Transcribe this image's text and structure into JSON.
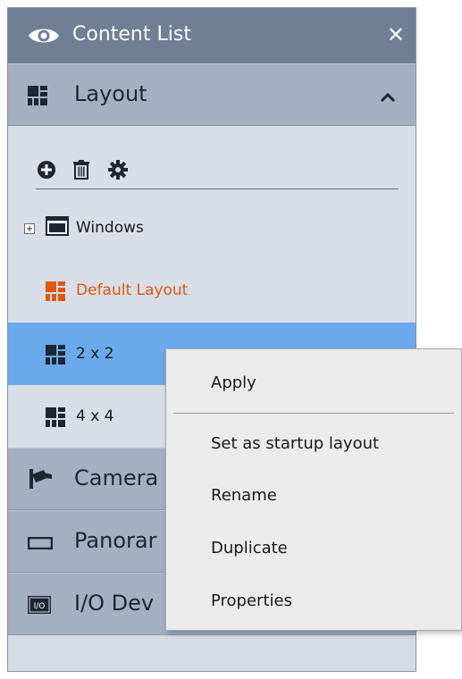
{
  "panel": {
    "title": "Content List",
    "close_glyph": "✕"
  },
  "sections": {
    "layout": {
      "label": "Layout",
      "expanded": true
    },
    "cameras": {
      "label": "Camera"
    },
    "panorama": {
      "label": "Panorar"
    },
    "io_devices": {
      "label": "I/O Dev"
    }
  },
  "toolbar": {
    "icons": [
      "add-icon",
      "trash-icon",
      "gear-icon"
    ]
  },
  "tree": {
    "items": [
      {
        "label": "Windows",
        "icon": "window-icon",
        "expander": "+"
      },
      {
        "label": "Default Layout",
        "icon": "layout-grid-icon",
        "color": "#e2580b"
      },
      {
        "label": "2 x 2",
        "icon": "layout-grid-icon",
        "selected": true
      },
      {
        "label": "4 x 4",
        "icon": "layout-grid-icon"
      }
    ]
  },
  "context_menu": {
    "items": [
      "Apply",
      "Set as startup layout",
      "Rename",
      "Duplicate",
      "Properties"
    ]
  },
  "colors": {
    "selected_row": "#6aa9ec",
    "default_layout": "#e2580b",
    "titlebar": "#6f7f96"
  }
}
